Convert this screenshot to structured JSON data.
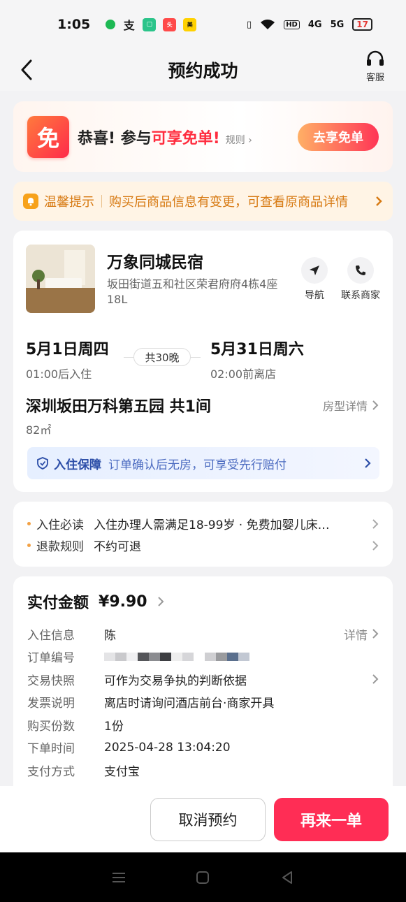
{
  "status_bar": {
    "time": "1:05",
    "signal_4g": "4G",
    "signal_5g": "5G",
    "hd": "HD",
    "battery": "17"
  },
  "header": {
    "title": "预约成功",
    "service_label": "客服"
  },
  "promo": {
    "badge": "免",
    "text_prefix": "恭喜! 参与",
    "text_highlight": "可享免单!",
    "rule_label": "规则",
    "button_label": "去享免单"
  },
  "notice": {
    "title": "温馨提示",
    "text": "购买后商品信息有变更，可查看原商品详情"
  },
  "hotel": {
    "name": "万象同城民宿",
    "address": "坂田街道五和社区荣君府府4栋4座18L",
    "nav_label": "导航",
    "contact_label": "联系商家",
    "checkin_date": "5月1日周四",
    "checkin_time": "01:00后入住",
    "nights": "共30晚",
    "checkout_date": "5月31日周六",
    "checkout_time": "02:00前离店",
    "room_name": "深圳坂田万科第五园 共1间",
    "room_size": "82㎡",
    "room_detail_label": "房型详情",
    "guarantee_title": "入住保障",
    "guarantee_text": "订单确认后无房，可享受先行赔付"
  },
  "rules": [
    {
      "label": "入住必读",
      "text": "入住办理人需满足18-99岁 · 免费加婴儿床…"
    },
    {
      "label": "退款规则",
      "text": "不约可退"
    }
  ],
  "order": {
    "paid_label": "实付金额",
    "paid_amount": "¥9.90",
    "rows": [
      {
        "label": "入住信息",
        "value": "陈",
        "right": "详情"
      },
      {
        "label": "订单编号",
        "value": ""
      },
      {
        "label": "交易快照",
        "value": "可作为交易争执的判断依据"
      },
      {
        "label": "发票说明",
        "value": "离店时请询问酒店前台·商家开具"
      },
      {
        "label": "购买份数",
        "value": "1份"
      },
      {
        "label": "下单时间",
        "value": "2025-04-28 13:04:20"
      },
      {
        "label": "支付方式",
        "value": "支付宝"
      }
    ]
  },
  "bottom": {
    "cancel_label": "取消预约",
    "again_label": "再来一单"
  },
  "colors": {
    "accent": "#ff2d55",
    "notice": "#d77a13",
    "guarantee": "#2c4ea8"
  }
}
